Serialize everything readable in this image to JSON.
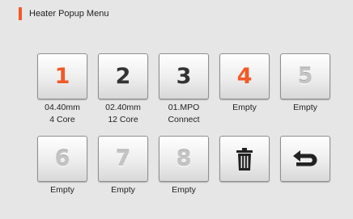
{
  "header": {
    "title": "Heater Popup Menu"
  },
  "colors": {
    "accent": "#f05a28",
    "active_number": "#f05a28",
    "normal_number": "#333333",
    "empty_number": "#c4c4c4"
  },
  "slots": [
    {
      "number": "1",
      "line1": "04.40mm",
      "line2": "4 Core",
      "state": "active"
    },
    {
      "number": "2",
      "line1": "02.40mm",
      "line2": "12 Core",
      "state": "normal"
    },
    {
      "number": "3",
      "line1": "01.MPO",
      "line2": "Connect",
      "state": "normal"
    },
    {
      "number": "4",
      "line1": "Empty",
      "line2": "",
      "state": "active"
    },
    {
      "number": "5",
      "line1": "Empty",
      "line2": "",
      "state": "empty"
    },
    {
      "number": "6",
      "line1": "Empty",
      "line2": "",
      "state": "empty"
    },
    {
      "number": "7",
      "line1": "Empty",
      "line2": "",
      "state": "empty"
    },
    {
      "number": "8",
      "line1": "Empty",
      "line2": "",
      "state": "empty"
    }
  ],
  "actions": {
    "delete_icon": "trash-icon",
    "back_icon": "return-arrow-icon"
  }
}
